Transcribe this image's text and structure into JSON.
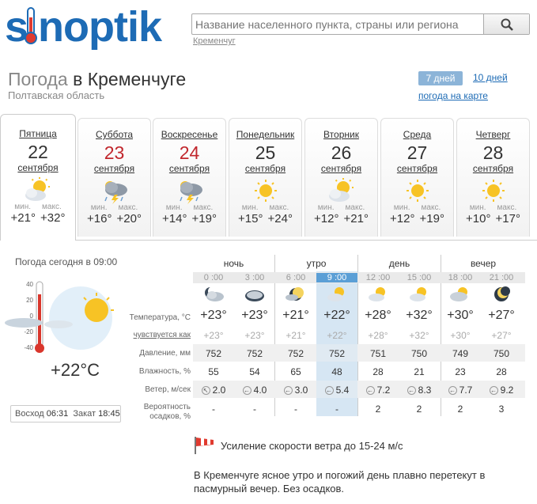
{
  "header": {
    "logo_text": "sinoptik",
    "search_placeholder": "Название населенного пункта, страны или региона",
    "search_hint": "Кременчуг"
  },
  "title": {
    "prefix": "Погода",
    "city": "в Кременчуге",
    "region": "Полтавская область"
  },
  "period_tabs": {
    "seven": "7 дней",
    "ten": "10 дней",
    "map": "погода на карте"
  },
  "days": [
    {
      "name": "Пятница",
      "num": "22",
      "month": "сентября",
      "min_label": "мин.",
      "max_label": "макс.",
      "min": "+21°",
      "max": "+32°",
      "icon": "sun-cloud-icon"
    },
    {
      "name": "Суббота",
      "num": "23",
      "month": "сентября",
      "min_label": "мин.",
      "max_label": "макс.",
      "min": "+16°",
      "max": "+20°",
      "icon": "thunderstorm-icon"
    },
    {
      "name": "Воскресенье",
      "num": "24",
      "month": "сентября",
      "min_label": "мин.",
      "max_label": "макс.",
      "min": "+14°",
      "max": "+19°",
      "icon": "thunderstorm-icon"
    },
    {
      "name": "Понедельник",
      "num": "25",
      "month": "сентября",
      "min_label": "мин.",
      "max_label": "макс.",
      "min": "+15°",
      "max": "+24°",
      "icon": "sun-icon"
    },
    {
      "name": "Вторник",
      "num": "26",
      "month": "сентября",
      "min_label": "мин.",
      "max_label": "макс.",
      "min": "+12°",
      "max": "+21°",
      "icon": "sun-cloud-icon"
    },
    {
      "name": "Среда",
      "num": "27",
      "month": "сентября",
      "min_label": "мин.",
      "max_label": "макс.",
      "min": "+12°",
      "max": "+19°",
      "icon": "sun-icon"
    },
    {
      "name": "Четверг",
      "num": "28",
      "month": "сентября",
      "min_label": "мин.",
      "max_label": "макс.",
      "min": "+10°",
      "max": "+17°",
      "icon": "sun-icon"
    }
  ],
  "today": {
    "title": "Погода сегодня в 09:00",
    "temp": "+22°C",
    "scale": [
      "40",
      "20",
      "0",
      "-20",
      "-40"
    ],
    "sunrise_label": "Восход",
    "sunrise": "06:31",
    "sunset_label": "Закат",
    "sunset": "18:45"
  },
  "periods": [
    "ночь",
    "утро",
    "день",
    "вечер"
  ],
  "times": [
    "0 :00",
    "3 :00",
    "6 :00",
    "9 :00",
    "12 :00",
    "15 :00",
    "18 :00",
    "21 :00"
  ],
  "hour_icons": [
    "cloud-moon-icon",
    "cloud-icon",
    "moon-cloud-icon",
    "sun-cloud-icon",
    "sun-cloud-icon",
    "sun-cloud-icon",
    "sun-cloud-icon",
    "moon-icon"
  ],
  "row_labels": {
    "temp": "Температура, °C",
    "feels": "чувствуется как",
    "pressure": "Давление, мм",
    "humidity": "Влажность, %",
    "wind": "Ветер, м/сек",
    "precip_1": "Вероятность",
    "precip_2": "осадков, %"
  },
  "rows": {
    "temp": [
      "+23°",
      "+23°",
      "+21°",
      "+22°",
      "+28°",
      "+32°",
      "+30°",
      "+27°"
    ],
    "feels": [
      "+23°",
      "+23°",
      "+21°",
      "+22°",
      "+28°",
      "+32°",
      "+30°",
      "+27°"
    ],
    "pressure": [
      "752",
      "752",
      "752",
      "752",
      "751",
      "750",
      "749",
      "750"
    ],
    "humidity": [
      "55",
      "54",
      "65",
      "48",
      "28",
      "21",
      "23",
      "28"
    ],
    "wind": [
      "2.0",
      "4.0",
      "3.0",
      "5.4",
      "7.2",
      "8.3",
      "7.7",
      "9.2"
    ],
    "wind_dir": [
      "↖",
      "←",
      "←",
      "←",
      "←",
      "←",
      "←",
      "←"
    ],
    "precip": [
      "-",
      "-",
      "-",
      "-",
      "2",
      "2",
      "2",
      "3"
    ]
  },
  "alert": "Усиление скорости ветра до 15-24 м/с",
  "description": "В Кременчуге ясное утро и погожий день плавно перетекут в пасмурный вечер. Без осадков.",
  "colors": {
    "brand": "#1d6bb5",
    "weekend": "#c1272d",
    "highlight": "#d6e6f3"
  }
}
